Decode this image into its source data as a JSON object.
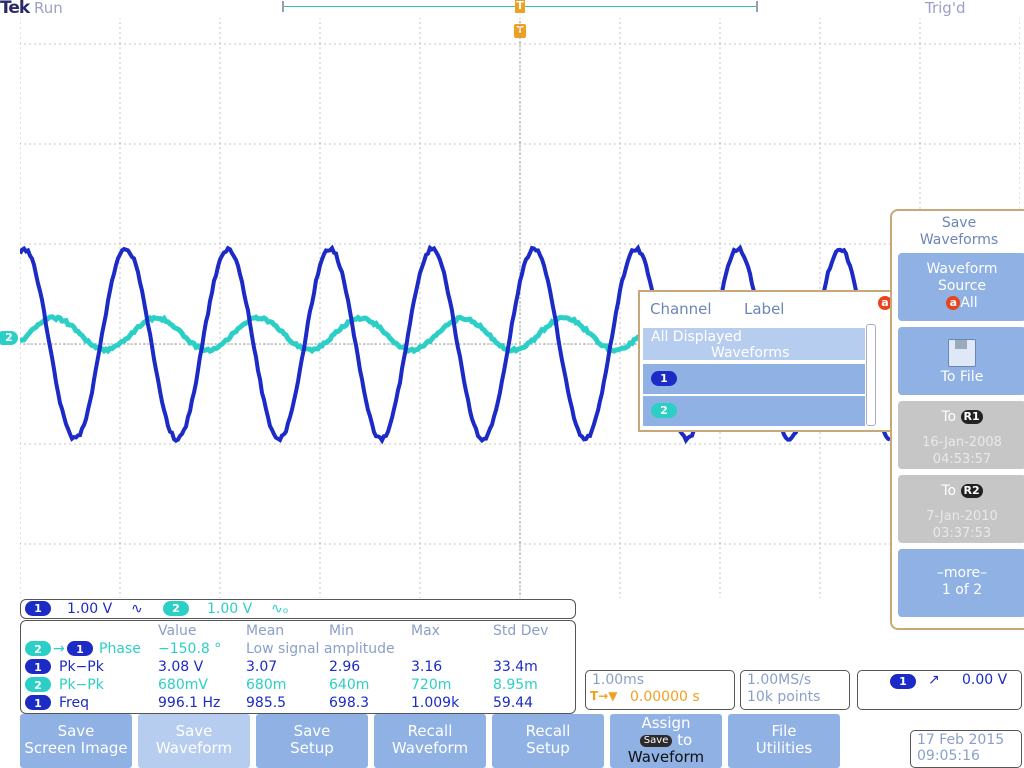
{
  "header": {
    "brand": "Tek",
    "run_status": "Run",
    "trigger_status": "Trig'd",
    "trigger_marker": "T"
  },
  "channel_markers": {
    "ch2": "2"
  },
  "colors": {
    "ch1": "#1c2ac6",
    "ch2": "#2ccfc6",
    "menu": "#8fb1e3",
    "menu_selected": "#b7cdef",
    "badge": "#e84420"
  },
  "side_menu": {
    "title_line1": "Save",
    "title_line2": "Waveforms",
    "source_line1": "Waveform",
    "source_line2": "Source",
    "source_badge": "a",
    "source_value": "All",
    "to_file_icon": "floppy-disk-icon",
    "to_file": "To File",
    "r1_to": "To",
    "r1_label": "R1",
    "r1_date": "16-Jan-2008",
    "r1_time": "04:53:57",
    "r2_to": "To",
    "r2_label": "R2",
    "r2_date": "7-Jan-2010",
    "r2_time": "03:37:53",
    "more": "–more–",
    "page": "1 of 2"
  },
  "popup": {
    "col_channel": "Channel",
    "col_label": "Label",
    "badge": "a",
    "all_line1": "All Displayed",
    "all_line2": "Waveforms",
    "row1": "1",
    "row2": "2"
  },
  "channel_bar": {
    "ch1": "1",
    "ch1_scale": "1.00 V",
    "ch1_coupling": "∿",
    "ch2": "2",
    "ch2_scale": "1.00 V",
    "ch2_coupling": "∿ₒ"
  },
  "measurements": {
    "headers": [
      "Value",
      "Mean",
      "Min",
      "Max",
      "Std Dev"
    ],
    "rows": [
      {
        "src": "2",
        "src2": "1",
        "name": "Phase",
        "value": "−150.8 °",
        "mean": "Low signal amplitude",
        "min": "",
        "max": "",
        "std": ""
      },
      {
        "src": "1",
        "name": "Pk−Pk",
        "value": "3.08 V",
        "mean": "3.07",
        "min": "2.96",
        "max": "3.16",
        "std": "33.4m"
      },
      {
        "src": "2",
        "name": "Pk−Pk",
        "value": "680mV",
        "mean": "680m",
        "min": "640m",
        "max": "720m",
        "std": "8.95m"
      },
      {
        "src": "1",
        "name": "Freq",
        "value": "996.1 Hz",
        "mean": "985.5",
        "min": "698.3",
        "max": "1.009k",
        "std": "59.44"
      }
    ]
  },
  "timebase": {
    "scale": "1.00ms",
    "delay": "0.00000 s",
    "trigger_glyph": "T→▼"
  },
  "acquisition": {
    "rate": "1.00MS/s",
    "points": "10k points"
  },
  "trigger": {
    "source": "1",
    "slope": "↗",
    "level": "0.00 V"
  },
  "bottom_menu": [
    {
      "l1": "Save",
      "l2": "Screen Image"
    },
    {
      "l1": "Save",
      "l2": "Waveform"
    },
    {
      "l1": "Save",
      "l2": "Setup"
    },
    {
      "l1": "Recall",
      "l2": "Waveform"
    },
    {
      "l1": "Recall",
      "l2": "Setup"
    },
    {
      "l1": "Assign",
      "chip": "Save",
      "to": "to",
      "l2": "Waveform"
    },
    {
      "l1": "File",
      "l2": "Utilities"
    }
  ],
  "datetime": {
    "date": "17 Feb  2015",
    "time": "09:05:16"
  }
}
